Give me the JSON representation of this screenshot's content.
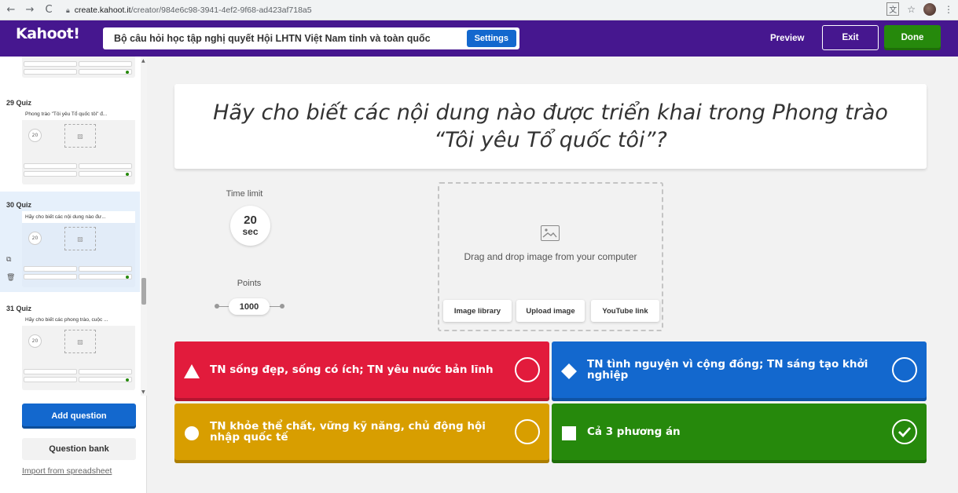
{
  "browser": {
    "url_host": "create.kahoot.it",
    "url_path": "/creator/984e6c98-3941-4ef2-9f68-ad423af718a5"
  },
  "header": {
    "logo": "Kahoot!",
    "kahoot_title": "Bộ câu hỏi học tập nghị quyết Hội LHTN Việt Nam tỉnh và toàn quốc",
    "settings_label": "Settings",
    "preview_label": "Preview",
    "exit_label": "Exit",
    "done_label": "Done"
  },
  "sidebar": {
    "slides": [
      {
        "label": "29 Quiz",
        "title": "Phong trào \"Tôi yêu Tổ quốc tôi\" đ...",
        "timer": "20"
      },
      {
        "label": "30 Quiz",
        "title": "Hãy cho biết các nội dung nào đư...",
        "timer": "20"
      },
      {
        "label": "31 Quiz",
        "title": "Hãy cho biết các phong trào, cuộc ...",
        "timer": "20"
      }
    ],
    "add_question_label": "Add question",
    "question_bank_label": "Question bank",
    "import_label": "Import from spreadsheet"
  },
  "editor": {
    "question": "Hãy cho biết các nội dung nào được triển khai trong Phong trào “Tôi yêu Tổ quốc tôi”?",
    "time_limit_label": "Time limit",
    "time_limit_value": "20",
    "time_limit_unit": "sec",
    "points_label": "Points",
    "points_value": "1000",
    "media_prompt": "Drag and drop image from your computer",
    "media_buttons": {
      "library": "Image library",
      "upload": "Upload image",
      "youtube": "YouTube link"
    }
  },
  "answers": [
    {
      "text": "TN sống đẹp, sống có ích; TN yêu nước bản lĩnh",
      "color": "#e21b3c",
      "shape": "triangle",
      "correct": false
    },
    {
      "text": "TN tình nguyện vì cộng đồng; TN sáng tạo khởi nghiệp",
      "color": "#1368ce",
      "shape": "diamond",
      "correct": false
    },
    {
      "text": "TN khỏe thể chất, vững kỹ năng, chủ động hội nhập quốc tế",
      "color": "#d89e00",
      "shape": "circle",
      "correct": false
    },
    {
      "text": "Cả 3 phương án",
      "color": "#26890c",
      "shape": "square",
      "correct": true
    }
  ]
}
